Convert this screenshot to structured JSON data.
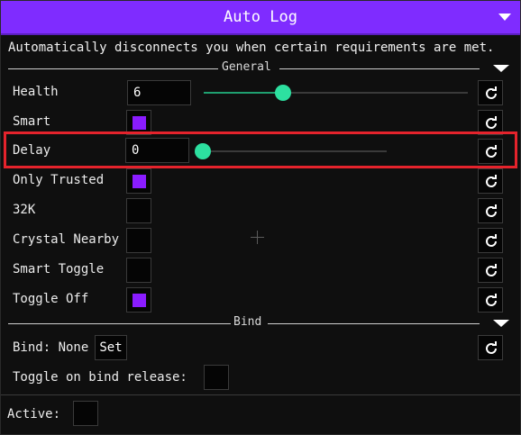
{
  "window": {
    "title": "Auto Log"
  },
  "description": "Automatically disconnects you when certain requirements are met.",
  "sections": {
    "general": "General",
    "bind": "Bind"
  },
  "settings": {
    "health": {
      "label": "Health",
      "value": "6",
      "slider_fraction": 0.29
    },
    "smart": {
      "label": "Smart",
      "checked": true
    },
    "delay": {
      "label": "Delay",
      "value": "0",
      "slider_fraction": 0.0
    },
    "only_trusted": {
      "label": "Only Trusted",
      "checked": true
    },
    "k32": {
      "label": "32K",
      "checked": false
    },
    "crystal_nearby": {
      "label": "Crystal Nearby",
      "checked": false
    },
    "smart_toggle": {
      "label": "Smart Toggle",
      "checked": false
    },
    "toggle_off": {
      "label": "Toggle Off",
      "checked": true
    }
  },
  "bind": {
    "label": "Bind: None",
    "set_label": "Set",
    "toggle_release_label": "Toggle on bind release:"
  },
  "active": {
    "label": "Active:"
  },
  "colors": {
    "accent": "#7f2cff",
    "check_fill": "#8a1cff",
    "slider_knob": "#2de0a0",
    "highlight": "#e5232c"
  },
  "icons": {
    "reset": "reset-icon",
    "collapse": "triangle-down-icon"
  }
}
